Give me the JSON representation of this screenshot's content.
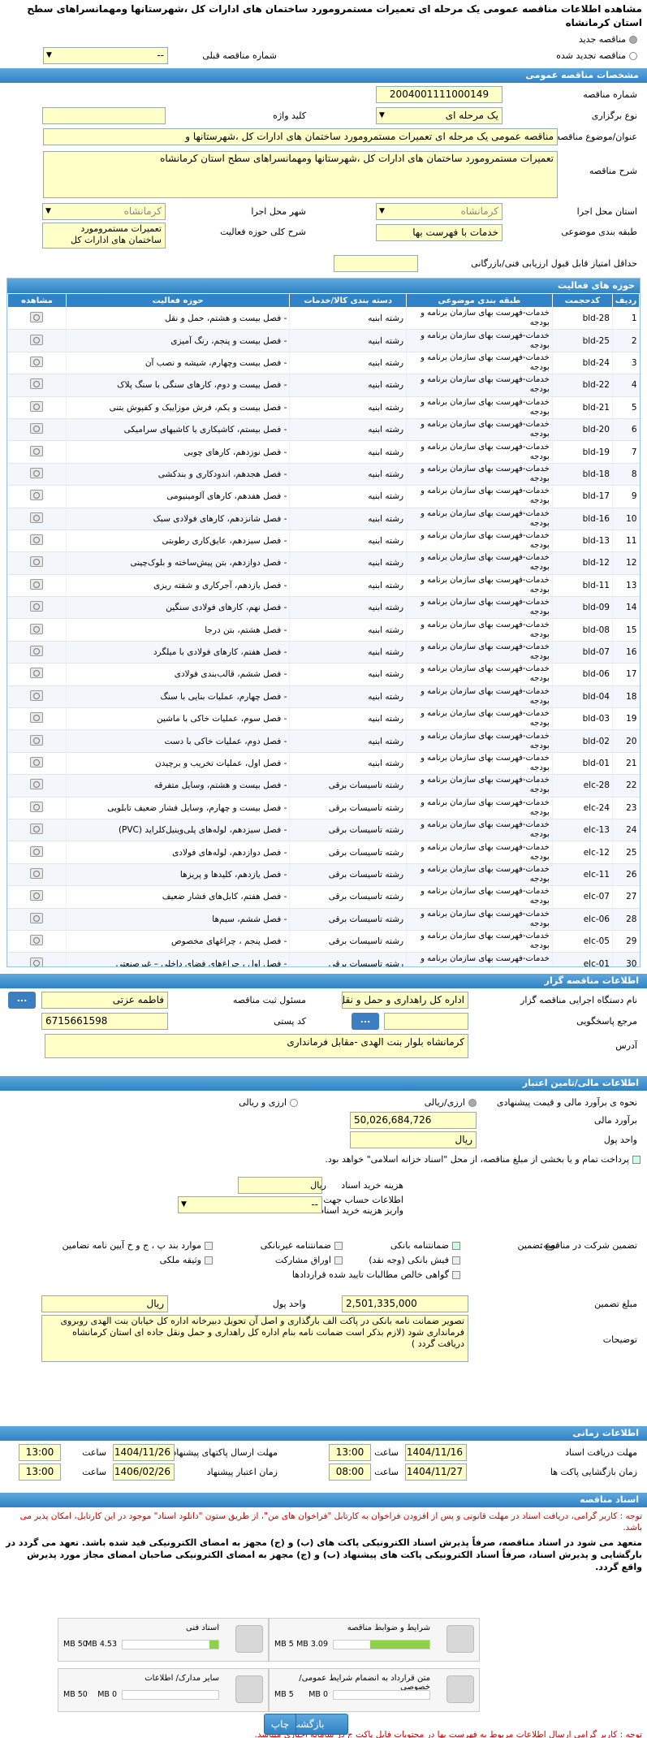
{
  "title": "مشاهده اطلاعات مناقصه عمومی یک مرحله ای تعمیرات مستمرومورد ساختمان های ادارات کل ،شهرستانها ومهمانسراهای سطح استان کرمانشاه",
  "mode": {
    "new": "مناقصه جدید",
    "renewed": "مناقصه تجدید شده",
    "prev_label": "شماره مناقصه قبلی",
    "prev_value": "--"
  },
  "general": {
    "header": "مشخصات مناقصه عمومی",
    "number_label": "شماره مناقصه",
    "number": "2004001111000149",
    "type_label": "نوع برگزاری",
    "type": "یک مرحله ای",
    "keyword_label": "کلید واژه",
    "subject_label": "عنوان/موضوع مناقصه",
    "subject": "مناقصه عمومی یک مرحله ای تعمیرات مستمرومورد ساختمان های ادارات کل ،شهرستانها و",
    "desc_label": "شرح مناقصه",
    "desc": "تعمیرات مستمرومورد ساختمان های ادارات کل ،شهرستانها ومهمانسراهای  سطح  استان کرمانشاه",
    "province_label": "استان محل اجرا",
    "province": "کرمانشاه",
    "city_label": "شهر محل اجرا",
    "city": "کرمانشاه",
    "category_label": "طبقه بندی موضوعی",
    "category": "خدمات با فهرست بها",
    "scope_label": "شرح کلی حوزه فعالیت",
    "scope": "تعمیرات مستمرومورد ساختمان های ادارات کل",
    "minscore_label": "حداقل امتیاز قابل قبول ارزیابی فنی/بازرگانی"
  },
  "activities": {
    "header": "حوزه های فعالیت",
    "cols": [
      "ردیف",
      "کدحجمت",
      "طبقه بندی موضوعی",
      "دسته بندی کالا/خدمات",
      "حوزه فعالیت",
      "مشاهده"
    ],
    "rows": [
      [
        "1",
        "bld-28",
        "خدمات-فهرست بهای سازمان برنامه و بودجه",
        "رشته ابنیه",
        "- فصل بیست و هشتم، حمل و نقل"
      ],
      [
        "2",
        "bld-25",
        "خدمات-فهرست بهای سازمان برنامه و بودجه",
        "رشته ابنیه",
        "- فصل بیست و پنجم، رنگ آمیزی"
      ],
      [
        "3",
        "bld-24",
        "خدمات-فهرست بهای سازمان برنامه و بودجه",
        "رشته ابنیه",
        "- فصل بیست وچهارم، شیشه و نصب آن"
      ],
      [
        "4",
        "bld-22",
        "خدمات-فهرست بهای سازمان برنامه و بودجه",
        "رشته ابنیه",
        "- فصل بیست و دوم، کارهای سنگی با سنگ پلاک"
      ],
      [
        "5",
        "bld-21",
        "خدمات-فهرست بهای سازمان برنامه و بودجه",
        "رشته ابنیه",
        "- فصل بیست و یکم، فرش موزاییک و کفپوش بتنی"
      ],
      [
        "6",
        "bld-20",
        "خدمات-فهرست بهای سازمان برنامه و بودجه",
        "رشته ابنیه",
        "- فصل بیستم، کاشیکاری یا کاشیهای سرامیکی"
      ],
      [
        "7",
        "bld-19",
        "خدمات-فهرست بهای سازمان برنامه و بودجه",
        "رشته ابنیه",
        "- فصل نوزدهم، کارهای چوبی"
      ],
      [
        "8",
        "bld-18",
        "خدمات-فهرست بهای سازمان برنامه و بودجه",
        "رشته ابنیه",
        "- فصل هجدهم، اندودکاری و بندکشی"
      ],
      [
        "9",
        "bld-17",
        "خدمات-فهرست بهای سازمان برنامه و بودجه",
        "رشته ابنیه",
        "- فصل هفدهم، کارهای آلومینیومی"
      ],
      [
        "10",
        "bld-16",
        "خدمات-فهرست بهای سازمان برنامه و بودجه",
        "رشته ابنیه",
        "- فصل شانزدهم، کارهای فولادی سبک"
      ],
      [
        "11",
        "bld-13",
        "خدمات-فهرست بهای سازمان برنامه و بودجه",
        "رشته ابنیه",
        "- فصل سیزدهم، عایق‌کاری رطوبتی"
      ],
      [
        "12",
        "bld-12",
        "خدمات-فهرست بهای سازمان برنامه و بودجه",
        "رشته ابنیه",
        "- فصل دوازدهم، بتن پیش‌ساخته و بلوک‌چینی"
      ],
      [
        "13",
        "bld-11",
        "خدمات-فهرست بهای سازمان برنامه و بودجه",
        "رشته ابنیه",
        "- فصل یازدهم، آجرکاری و شفته ریزی"
      ],
      [
        "14",
        "bld-09",
        "خدمات-فهرست بهای سازمان برنامه و بودجه",
        "رشته ابنیه",
        "- فصل نهم، کارهای فولادی سنگین"
      ],
      [
        "15",
        "bld-08",
        "خدمات-فهرست بهای سازمان برنامه و بودجه",
        "رشته ابنیه",
        "- فصل هشتم، بتن درجا"
      ],
      [
        "16",
        "bld-07",
        "خدمات-فهرست بهای سازمان برنامه و بودجه",
        "رشته ابنیه",
        "- فصل هفتم، کارهای فولادی با میلگرد"
      ],
      [
        "17",
        "bld-06",
        "خدمات-فهرست بهای سازمان برنامه و بودجه",
        "رشته ابنیه",
        "- فصل ششم، قالب‌بندی فولادی"
      ],
      [
        "18",
        "bld-04",
        "خدمات-فهرست بهای سازمان برنامه و بودجه",
        "رشته ابنیه",
        "- فصل چهارم، عملیات بنایی با سنگ"
      ],
      [
        "19",
        "bld-03",
        "خدمات-فهرست بهای سازمان برنامه و بودجه",
        "رشته ابنیه",
        "- فصل سوم، عملیات خاکی با ماشین"
      ],
      [
        "20",
        "bld-02",
        "خدمات-فهرست بهای سازمان برنامه و بودجه",
        "رشته ابنیه",
        "- فصل دوم، عملیات خاکی با دست"
      ],
      [
        "21",
        "bld-01",
        "خدمات-فهرست بهای سازمان برنامه و بودجه",
        "رشته ابنیه",
        "- فصل اول، عملیات تخریب و برچیدن"
      ],
      [
        "22",
        "elc-28",
        "خدمات-فهرست بهای سازمان برنامه و بودجه",
        "رشته تاسیسات برقی",
        "- فصل بیست و هشتم، وسایل متفرقه"
      ],
      [
        "23",
        "elc-24",
        "خدمات-فهرست بهای سازمان برنامه و بودجه",
        "رشته تاسیسات برقی",
        "- فصل بیست و چهارم، وسایل فشار ضعیف تابلویی"
      ],
      [
        "24",
        "elc-13",
        "خدمات-فهرست بهای سازمان برنامه و بودجه",
        "رشته تاسیسات برقی",
        "- فصل سیزدهم، لوله‌های پلی‌وینیل‌کلراید (PVC)"
      ],
      [
        "25",
        "elc-12",
        "خدمات-فهرست بهای سازمان برنامه و بودجه",
        "رشته تاسیسات برقی",
        "- فصل دوازدهم، لوله‌های فولادی"
      ],
      [
        "26",
        "elc-11",
        "خدمات-فهرست بهای سازمان برنامه و بودجه",
        "رشته تاسیسات برقی",
        "- فصل یازدهم، کلیدها و پریزها"
      ],
      [
        "27",
        "elc-07",
        "خدمات-فهرست بهای سازمان برنامه و بودجه",
        "رشته تاسیسات برقی",
        "- فصل هفتم، کابل‌های فشار ضعیف"
      ],
      [
        "28",
        "elc-06",
        "خدمات-فهرست بهای سازمان برنامه و بودجه",
        "رشته تاسیسات برقی",
        "- فصل ششم، سیم‌ها"
      ],
      [
        "29",
        "elc-05",
        "خدمات-فهرست بهای سازمان برنامه و بودجه",
        "رشته تاسیسات برقی",
        "- فصل پنجم ، چراغهای مخصوص"
      ],
      [
        "30",
        "elc-01",
        "خدمات-فهرست بهای سازمان برنامه و بودجه",
        "رشته تاسیسات برقی",
        "- فصل اول ، چراغ‌های فضای داخلی – غیرصنعتی"
      ]
    ]
  },
  "organizer": {
    "header": "اطلاعات مناقصه گزار",
    "org_label": "نام دستگاه اجرایی مناقصه گزار",
    "org": "اداره کل راهداری و حمل و نقل جاده ای",
    "resp_label": "مسئول ثبت مناقصه",
    "resp": "فاطمه  عزتی",
    "ref_label": "مرجع پاسخگویی",
    "postal_label": "کد پستی",
    "postal": "6715661598",
    "addr_label": "آدرس",
    "addr": "کرمانشاه بلوار بنت الهدی -مقابل فرمانداری",
    "dots": "..."
  },
  "finance": {
    "header": "اطلاعات مالی/تامین اعتبار",
    "method_label": "نحوه ی برآورد مالی و قیمت پیشنهادی",
    "opt1": "ارزی/ریالی",
    "opt2": "ارزی و ریالی",
    "est_label": "برآورد مالی",
    "est": "50,026,684,726",
    "cur_label": "واحد پول",
    "cur": "ریال",
    "pay_text": "پرداخت تمام و یا بخشی از مبلغ مناقصه، از محل \"اسناد خزانه اسلامی\" خواهد بود.",
    "fee_label": "هزینه خرید اسناد",
    "fee_unit": "ریال",
    "acct_label": "اطلاعات حساب جهت واریز هزینه خرید اسناد",
    "acct": "--",
    "guar_label": "تضمین شرکت در مناقصه:",
    "gtype_label": "نوع تضمین",
    "g1": "ضمانتنامه بانکی",
    "g2": "ضمانتنامه غیربانکی",
    "g3": "موارد بند پ ، ج و خ آیین نامه تضامین",
    "g4": "فیش بانکی (وجه نقد)",
    "g5": "اوراق مشارکت",
    "g6": "وثیقه ملکی",
    "g7": "گواهی خالص مطالبات تایید شده قراردادها",
    "gamount_label": "مبلغ تضمین",
    "gamount": "2,501,335,000",
    "gcur_label": "واحد پول",
    "gcur": "ریال",
    "gdesc_label": "توضیحات",
    "gdesc": "تصویر ضمانت نامه بانکی در پاکت الف بارگذاری و اصل آن تحویل دبیرخانه اداره کل خیابان بنت الهدی روبروی فرمانداری شود (لازم بذکر است ضمانت نامه بنام اداره کل راهداری و حمل ونقل جاده ای استان کرمانشاه دریافت گردد )"
  },
  "times": {
    "header": "اطلاعات زمانی",
    "doc_recv_label": "مهلت دریافت اسناد",
    "doc_recv_date": "1404/11/16",
    "doc_recv_time": "13:00",
    "send_label": "مهلت ارسال پاکتهای پیشنهاد",
    "send_date": "1404/11/26",
    "send_time": "13:00",
    "open_label": "زمان بازگشایی پاکت ها",
    "open_date": "1404/11/27",
    "open_time": "08:00",
    "valid_label": "زمان اعتبار پیشنهاد",
    "valid_date": "1406/02/26",
    "valid_time": "13:00",
    "time_label": "ساعت"
  },
  "docs": {
    "header": "اسناد مناقصه",
    "note1": "توجه : کاربر گرامی، دریافت اسناد در مهلت قانونی و پس از افزودن فراخوان به کارتابل \"فراخوان های من\"، از طریق ستون \"دانلود اسناد\" موجود در این کارتابل، امکان پذیر می باشد.",
    "note2": "متعهد می شود در اسناد مناقصه، صرفاً پذیرش اسناد الکترونیکی پاکت های (ب) و (ج) مجهز به امضای الکترونیکی قید شده باشد. تعهد می گردد در بارگشایی و پذیرش اسناد، صرفاً اسناد الکترونیکی پاکت های پیشنهاد (ب) و (ج) مجهز به امضای الکترونیکی صاحبان امضای مجاز مورد پذیرش واقع گردد.",
    "items": [
      {
        "name": "شرایط و ضوابط مناقصه",
        "used": "3.09 MB",
        "max": "5 MB",
        "fill": 0.62
      },
      {
        "name": "اسناد فنی",
        "used": "4.53 MB",
        "max": "50 MB",
        "fill": 0.09
      },
      {
        "name": "متن قرارداد به انضمام شرایط عمومی/خصوصی",
        "used": "0 MB",
        "max": "5 MB",
        "fill": 0
      },
      {
        "name": "سایر مدارک/ اطلاعات",
        "used": "0 MB",
        "max": "50 MB",
        "fill": 0
      }
    ],
    "note3": "توجه : کاربر گرامی ارسال اطلاعات مربوط به فهرست بها در محتویات فایل پاکت ج در سامانه اجباری میباشد."
  },
  "buttons": {
    "print": "چاپ",
    "back": "بازگشت"
  }
}
